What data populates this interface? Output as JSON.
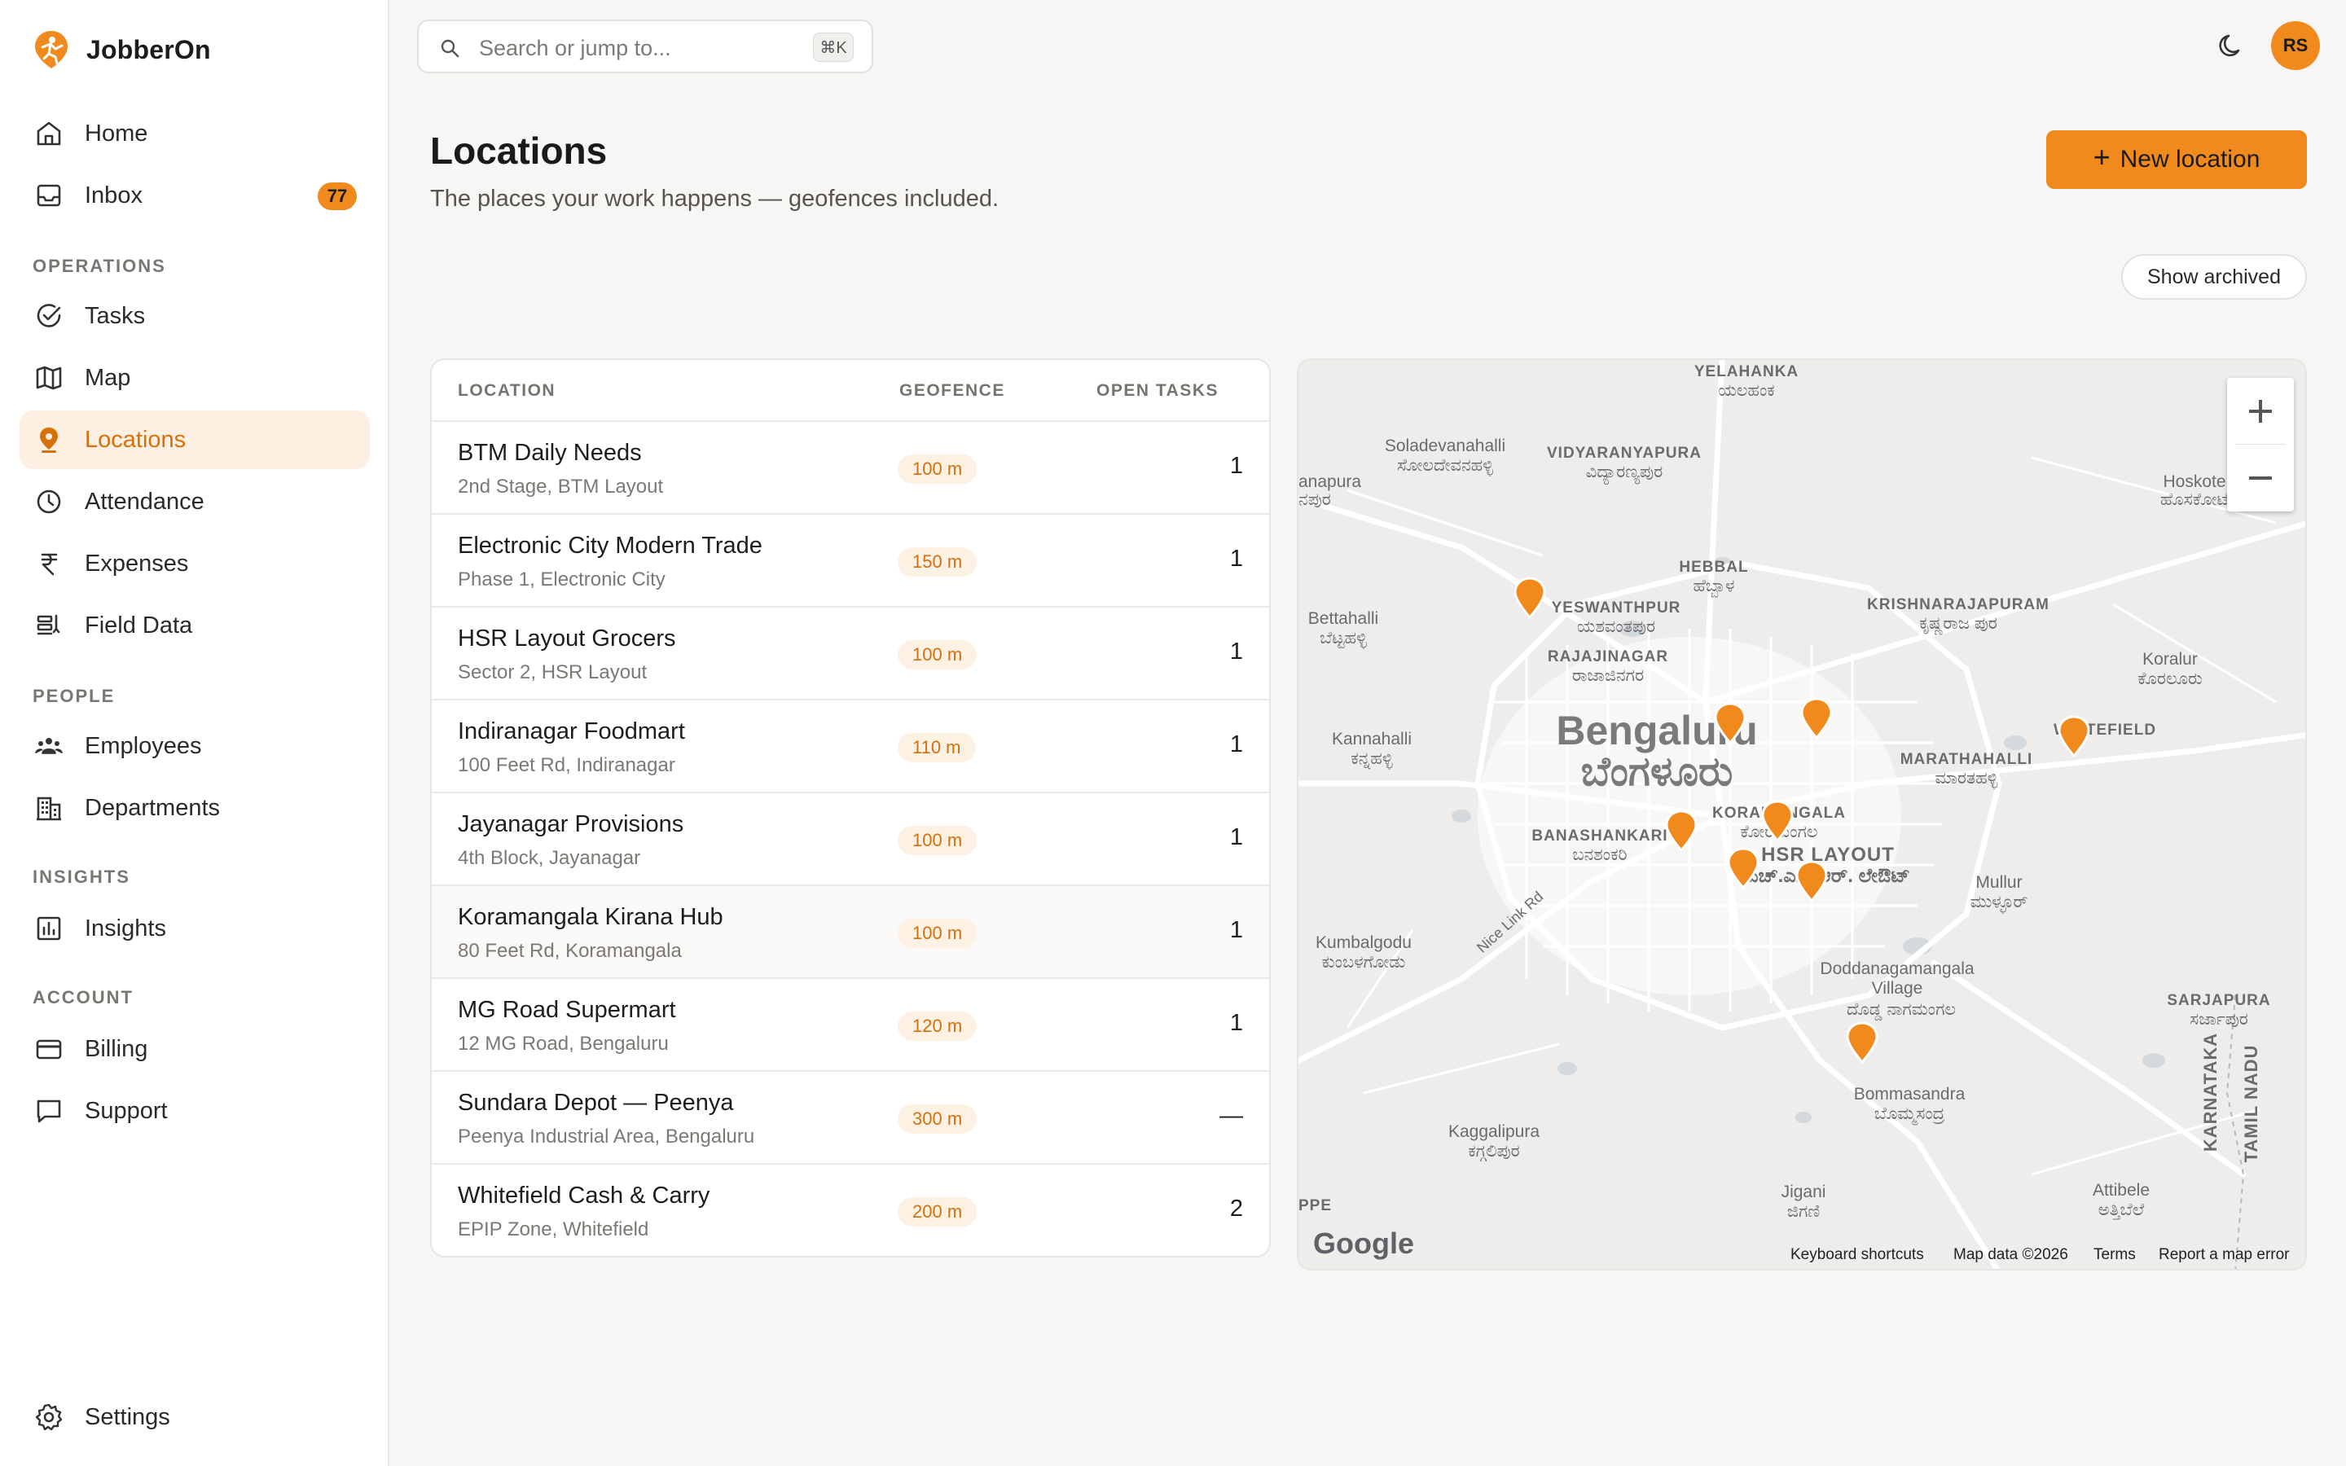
{
  "app": {
    "name": "JobberOn"
  },
  "search": {
    "placeholder": "Search or jump to...",
    "shortcut": "⌘K"
  },
  "user": {
    "initials": "RS"
  },
  "sidebar": {
    "items": [
      {
        "label": "Home",
        "icon": "home-icon"
      },
      {
        "label": "Inbox",
        "icon": "inbox-icon",
        "badge": "77"
      }
    ],
    "sections": [
      {
        "title": "OPERATIONS",
        "items": [
          {
            "label": "Tasks",
            "icon": "check-circle-icon"
          },
          {
            "label": "Map",
            "icon": "map-icon"
          },
          {
            "label": "Locations",
            "icon": "location-pin-icon",
            "active": true
          },
          {
            "label": "Attendance",
            "icon": "clock-icon"
          },
          {
            "label": "Expenses",
            "icon": "rupee-icon"
          },
          {
            "label": "Field Data",
            "icon": "field-data-icon"
          }
        ]
      },
      {
        "title": "PEOPLE",
        "items": [
          {
            "label": "Employees",
            "icon": "people-icon"
          },
          {
            "label": "Departments",
            "icon": "building-icon"
          }
        ]
      },
      {
        "title": "INSIGHTS",
        "items": [
          {
            "label": "Insights",
            "icon": "bar-chart-icon"
          }
        ]
      },
      {
        "title": "ACCOUNT",
        "items": [
          {
            "label": "Billing",
            "icon": "credit-card-icon"
          },
          {
            "label": "Support",
            "icon": "chat-icon"
          }
        ]
      }
    ],
    "footer": {
      "label": "Settings",
      "icon": "gear-icon"
    }
  },
  "page": {
    "title": "Locations",
    "subtitle": "The places your work happens — geofences included.",
    "new_button": "New location",
    "show_archived": "Show archived"
  },
  "table": {
    "headers": {
      "location": "LOCATION",
      "geofence": "GEOFENCE",
      "open_tasks": "OPEN TASKS"
    },
    "rows": [
      {
        "name": "BTM Daily Needs",
        "address": "2nd Stage, BTM Layout",
        "geofence": "100 m",
        "open_tasks": "1"
      },
      {
        "name": "Electronic City Modern Trade",
        "address": "Phase 1, Electronic City",
        "geofence": "150 m",
        "open_tasks": "1"
      },
      {
        "name": "HSR Layout Grocers",
        "address": "Sector 2, HSR Layout",
        "geofence": "100 m",
        "open_tasks": "1"
      },
      {
        "name": "Indiranagar Foodmart",
        "address": "100 Feet Rd, Indiranagar",
        "geofence": "110 m",
        "open_tasks": "1"
      },
      {
        "name": "Jayanagar Provisions",
        "address": "4th Block, Jayanagar",
        "geofence": "100 m",
        "open_tasks": "1"
      },
      {
        "name": "Koramangala Kirana Hub",
        "address": "80 Feet Rd, Koramangala",
        "geofence": "100 m",
        "open_tasks": "1"
      },
      {
        "name": "MG Road Supermart",
        "address": "12 MG Road, Bengaluru",
        "geofence": "120 m",
        "open_tasks": "1"
      },
      {
        "name": "Sundara Depot — Peenya",
        "address": "Peenya Industrial Area, Bengaluru",
        "geofence": "300 m",
        "open_tasks": "—"
      },
      {
        "name": "Whitefield Cash & Carry",
        "address": "EPIP Zone, Whitefield",
        "geofence": "200 m",
        "open_tasks": "2"
      }
    ]
  },
  "map": {
    "zoom_in": "+",
    "zoom_out": "−",
    "logo": "Google",
    "attribution": {
      "keyboard": "Keyboard shortcuts",
      "data": "Map data ©2026",
      "terms": "Terms",
      "report": "Report a map error"
    },
    "labels": {
      "yelahanka": "YELAHANKA",
      "yelahanka_kn": "ಯಲಹಂಕ",
      "soladevanahalli": "Soladevanahalli",
      "soladevanahalli_kn": "ಸೋಲದೇವನಹಳ್ಳಿ",
      "vidyaranyapura": "VIDYARANYAPURA",
      "vidyaranyapura_kn": "ವಿದ್ಯಾರಣ್ಯಪುರ",
      "anapura": "anapura",
      "anapura_kn": "ನಪುರ",
      "hoskote": "Hoskote",
      "hoskote_kn": "ಹೊಸಕೋಟೆ",
      "hebbal": "HEBBAL",
      "hebbal_kn": "ಹೆಬ್ಬಾಳ",
      "yeshwanthpur": "YESWANTHPUR",
      "yeshwanthpur_kn": "ಯಶವಂತಪುರ",
      "krishnarajapuram": "KRISHNARAJAPURAM",
      "krishnarajapuram_kn": "ಕೃಷ್ಣರಾಜ ಪುರ",
      "bettahalli": "Bettahalli",
      "bettahalli_kn": "ಬೆಟ್ಟಹಳ್ಳಿ",
      "rajajinagar": "RAJAJINAGAR",
      "rajajinagar_kn": "ರಾಜಾಜಿನಗರ",
      "koralur": "Koralur",
      "koralur_kn": "ಕೊರಲೂರು",
      "bengaluru": "Bengaluru",
      "bengaluru_kn": "ಬೆಂಗಳೂರು",
      "kannahalli": "Kannahalli",
      "kannahalli_kn": "ಕನ್ನಹಳ್ಳಿ",
      "whitefield": "WHITEFIELD",
      "marathahalli": "MARATHAHALLI",
      "marathahalli_kn": "ಮಾರತಹಳ್ಳಿ",
      "koramangala": "KORAMANGALA",
      "koramangala_kn": "ಕೋರಮಂಗಲ",
      "banashankari": "BANASHANKARI",
      "banashankari_kn": "ಬನಶಂಕರಿ",
      "hsr_layout": "HSR LAYOUT",
      "hsr_layout_kn": "ಎಚ್.ಎಸ್.ಆರ್. ಲೇಔಟ್",
      "mullur": "Mullur",
      "mullur_kn": "ಮುಳ್ಳೂರ್",
      "nice_link": "Nice Link Rd",
      "kumbalgodu": "Kumbalgodu",
      "kumbalgodu_kn": "ಕುಂಬಳಗೋಡು",
      "doddanagamangala": "Doddanagamangala Village",
      "doddanagamangala_kn": "ದೊಡ್ಡ ನಾಗಮಂಗಲ",
      "sarjapura": "SARJAPURA",
      "sarjapura_kn": "ಸರ್ಜಾಪುರ",
      "karnataka": "KARNATAKA",
      "tamil_nadu": "TAMIL NADU",
      "bommasandra": "Bommasandra",
      "bommasandra_kn": "ಬೊಮ್ಮಸಂದ್ರ",
      "kaggalipura": "Kaggalipura",
      "kaggalipura_kn": "ಕಗ್ಗಲಿಪುರ",
      "attibele": "Attibele",
      "attibele_kn": "ಅತ್ತಿಬೆಲೆ",
      "jigani": "Jigani",
      "jigani_kn": "ಜಿಗಣಿ",
      "ppe": "PPE"
    },
    "accent_color": "#f08a1c"
  }
}
